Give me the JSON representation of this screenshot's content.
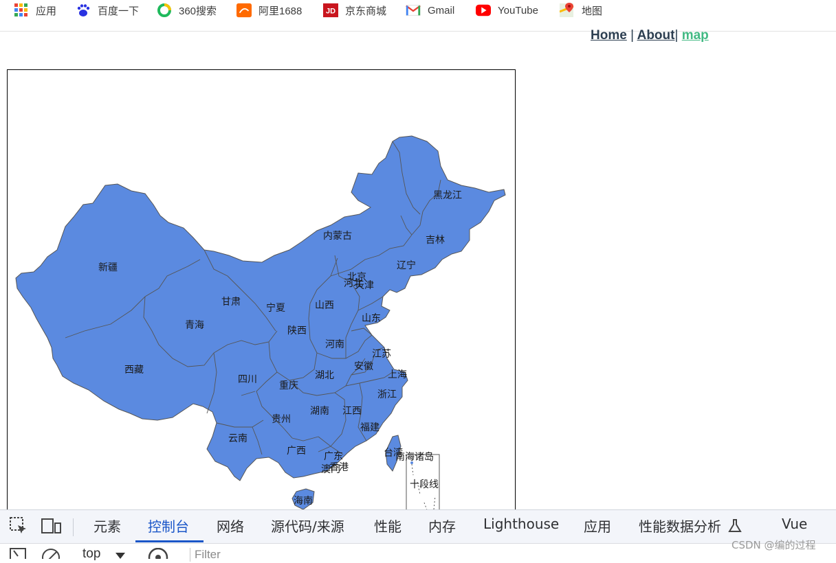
{
  "bookmarks": [
    {
      "label": "应用",
      "icon": "apps-grid-icon"
    },
    {
      "label": "百度一下",
      "icon": "baidu-paw-icon"
    },
    {
      "label": "360搜索",
      "icon": "search-360-icon"
    },
    {
      "label": "阿里1688",
      "icon": "alibaba-1688-icon"
    },
    {
      "label": "京东商城",
      "icon": "jd-icon"
    },
    {
      "label": "Gmail",
      "icon": "gmail-icon"
    },
    {
      "label": "YouTube",
      "icon": "youtube-icon"
    },
    {
      "label": "地图",
      "icon": "google-maps-icon"
    }
  ],
  "nav": {
    "home": "Home",
    "sep1": "|",
    "about": "About",
    "sep2": "|",
    "map": "map"
  },
  "map": {
    "fill_color": "#5b8ae0",
    "border_color": "#555555",
    "labels": {
      "heilongjiang": "黑龙江",
      "jilin": "吉林",
      "liaoning": "辽宁",
      "neimenggu": "内蒙古",
      "xinjiang": "新疆",
      "gansu": "甘肃",
      "ningxia": "宁夏",
      "shanxi1": "山西",
      "beijing": "北京",
      "hebei": "河北",
      "tianjin": "天津",
      "shandong": "山东",
      "qinghai": "青海",
      "shaanxi": "陕西",
      "henan": "河南",
      "jiangsu": "江苏",
      "xizang": "西藏",
      "sichuan": "四川",
      "anhui": "安徽",
      "hubei": "湖北",
      "shanghai": "上海",
      "chongqing": "重庆",
      "zhejiang": "浙江",
      "guizhou": "贵州",
      "hunan": "湖南",
      "jiangxi": "江西",
      "fujian": "福建",
      "yunnan": "云南",
      "guangxi": "广西",
      "guangdong": "广东",
      "taiwan": "台湾",
      "xianggang": "香港",
      "aomen": "澳门",
      "hainan": "海南",
      "nanhai": "南海诸岛",
      "shiduanxian": "十段线"
    }
  },
  "devtools": {
    "tabs": [
      "元素",
      "控制台",
      "网络",
      "源代码/来源",
      "性能",
      "内存",
      "Lighthouse",
      "应用",
      "性能数据分析",
      "Vue"
    ],
    "active_tab": "控制台",
    "context": "top",
    "filter_placeholder": "Filter"
  },
  "watermark": "CSDN @编的过程"
}
